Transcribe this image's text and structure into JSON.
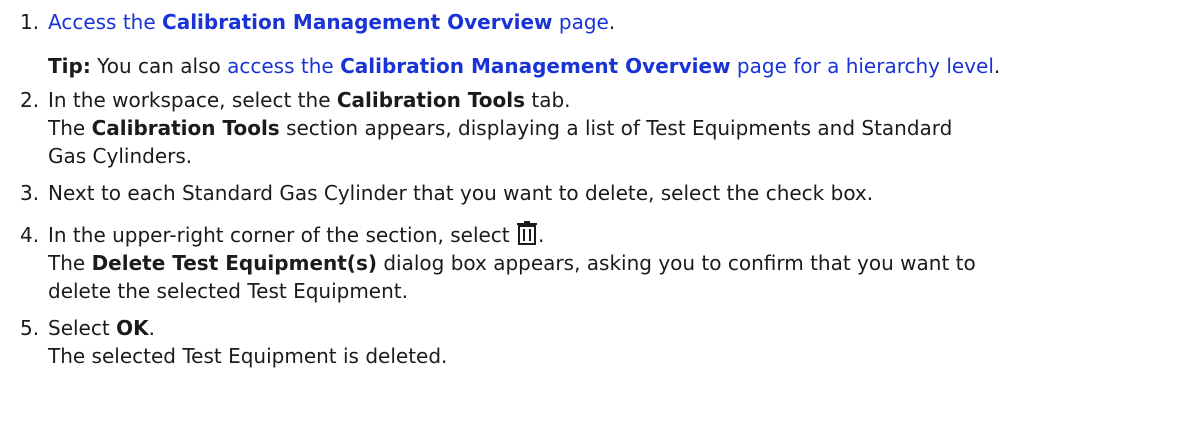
{
  "steps": [
    {
      "num": "1.",
      "link_pre": "Access the ",
      "link_bold": "Calibration Management Overview",
      "link_post": " page",
      "end": ".",
      "tip": {
        "label": "Tip:",
        "pre": " You can also ",
        "link_pre": "access the ",
        "link_bold": "Calibration Management Overview",
        "link_post": " page for a hierarchy level",
        "end": "."
      }
    },
    {
      "num": "2.",
      "pre": "In the workspace, select the ",
      "bold": "Calibration Tools",
      "post": " tab.",
      "result_bold": "Calibration Tools",
      "result_line1": " section appears, displaying a list of Test Equipments and Standard",
      "result_line2": "Gas Cylinders.",
      "result_pre": "The "
    },
    {
      "num": "3.",
      "text": "Next to each Standard Gas Cylinder that you want to delete, select the check box."
    },
    {
      "num": "4.",
      "pre": "In the upper-right corner of the section, select ",
      "icon": "trash-icon",
      "post": ".",
      "result_pre": "The ",
      "result_bold": "Delete Test Equipment(s)",
      "result_line1": " dialog box appears, asking you to confirm that you want to",
      "result_line2": "delete the selected Test Equipment."
    },
    {
      "num": "5.",
      "pre": "Select ",
      "bold": "OK",
      "post": ".",
      "result": "The selected Test Equipment is deleted."
    }
  ],
  "colors": {
    "link": "#1a33d6",
    "text": "#1b1b1b"
  }
}
